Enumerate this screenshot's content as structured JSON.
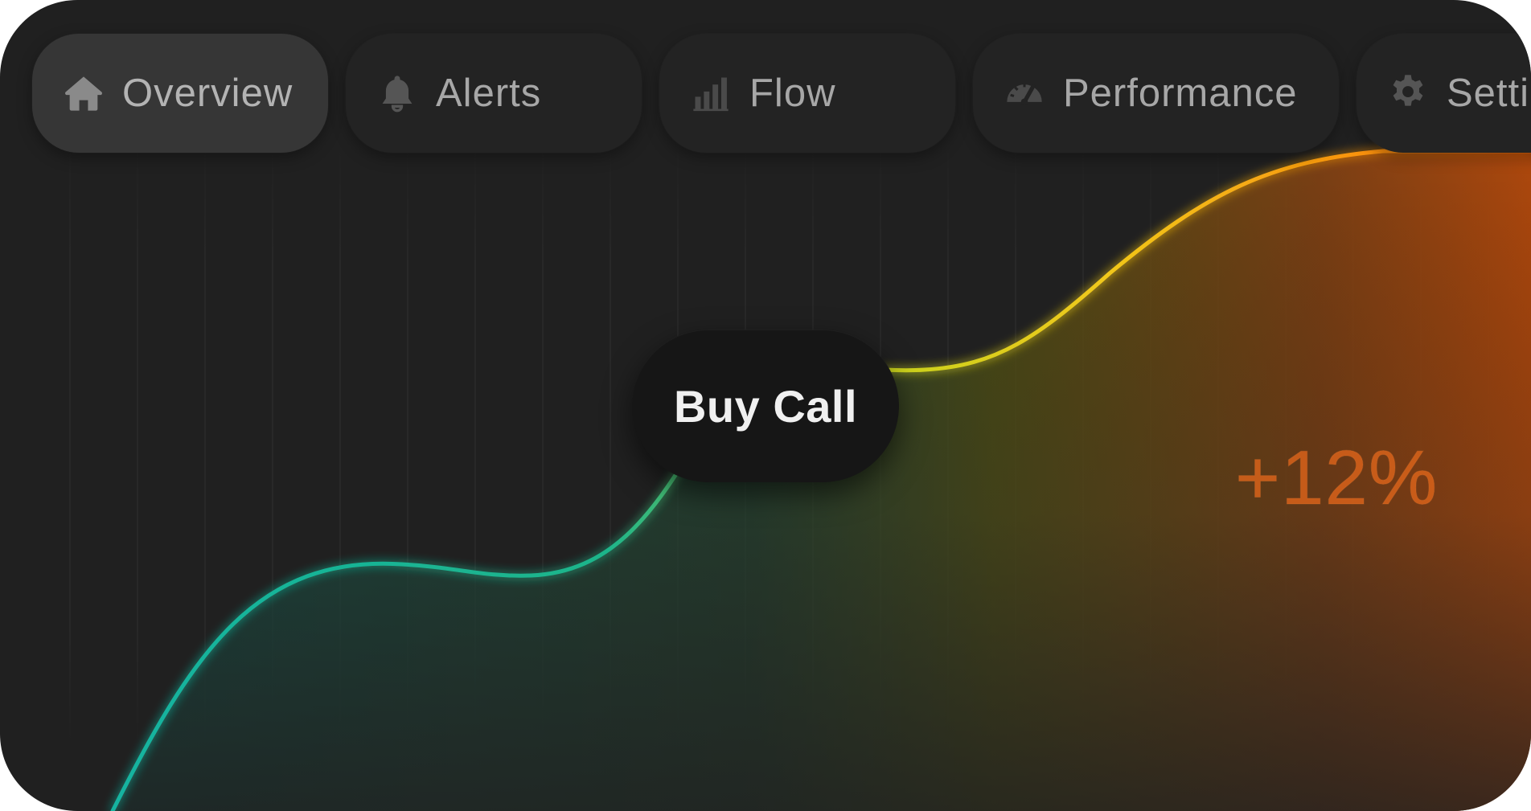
{
  "tabs": [
    {
      "label": "Overview",
      "icon": "home-icon",
      "active": true
    },
    {
      "label": "Alerts",
      "icon": "bell-icon",
      "active": false
    },
    {
      "label": "Flow",
      "icon": "bar-chart-icon",
      "active": false
    },
    {
      "label": "Performance",
      "icon": "gauge-icon",
      "active": false
    },
    {
      "label": "Setti",
      "icon": "gear-icon",
      "active": false
    }
  ],
  "action": {
    "label": "Buy Call"
  },
  "stat": {
    "change": "+12%"
  },
  "colors": {
    "background": "#202020",
    "curve_start": "#12b3a0",
    "curve_mid": "#e5d21c",
    "curve_end": "#ff7a0a",
    "percent": "#d8621a"
  }
}
